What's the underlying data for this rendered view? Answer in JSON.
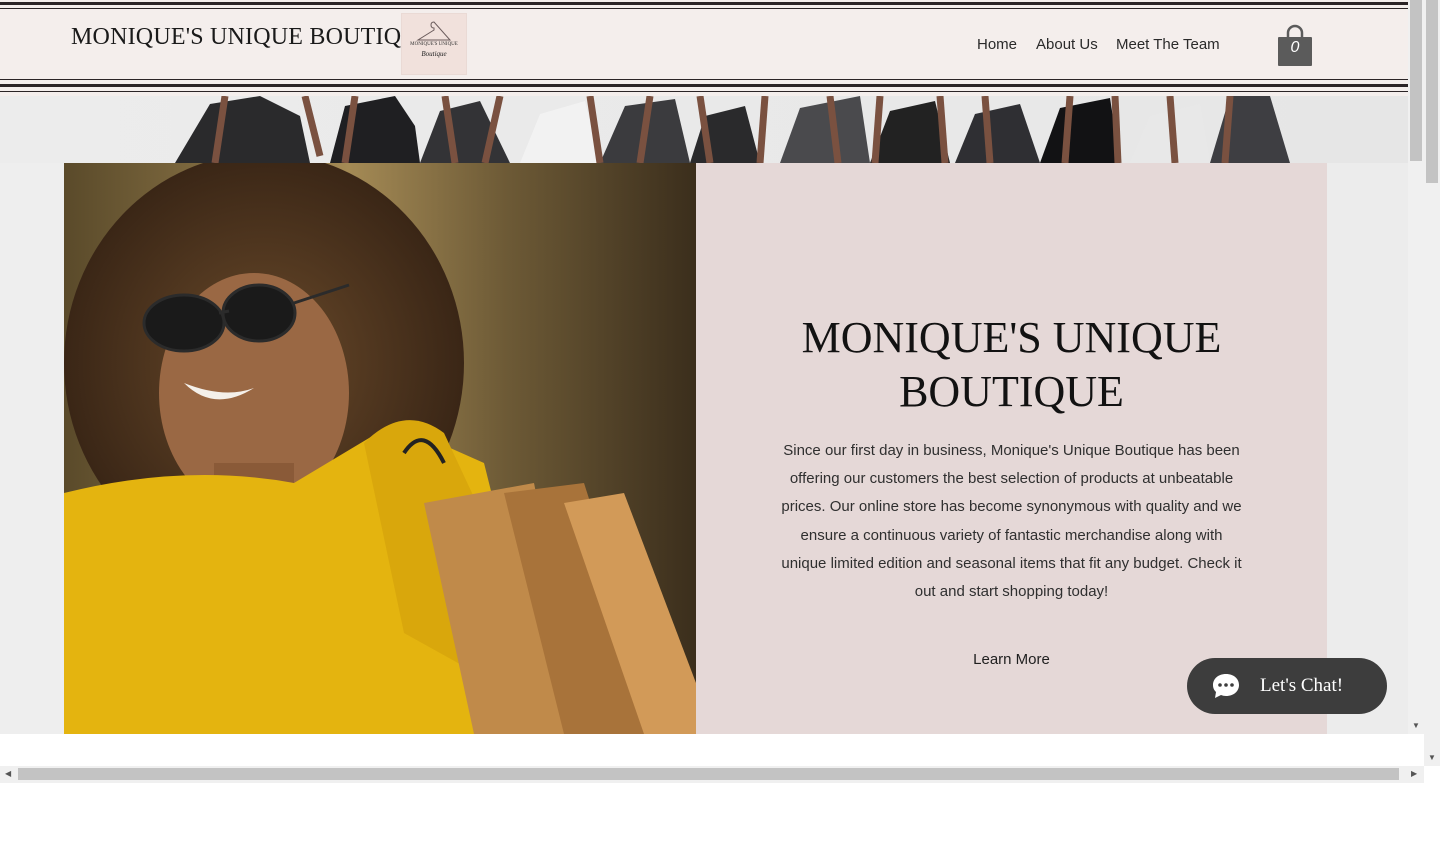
{
  "header": {
    "brand": "MONIQUE'S UNIQUE BOUTIQUE",
    "logo": {
      "line1": "MONIQUE'S UNIQUE",
      "line2": "Boutique"
    },
    "nav": [
      "Home",
      "About Us",
      "Meet The Team"
    ],
    "cart_count": "0"
  },
  "hero": {
    "title_line1": "MONIQUE'S UNIQUE",
    "title_line2": "BOUTIQUE",
    "text": "Since our first day in business, Monique's Unique Boutique has been offering our customers the best selection of products at unbeatable prices. Our online store has become synonymous with quality and we ensure a continuous variety of fantastic merchandise along with unique limited edition and seasonal items that fit any budget. Check it out and start shopping today!",
    "cta": "Learn More",
    "image": "woman-with-shopping-bags"
  },
  "chat": {
    "label": "Let's Chat!",
    "icon": "chat-bubble-icon"
  },
  "colors": {
    "header_bg": "#f4eeec",
    "panel_bg": "#e5d8d7",
    "chat_bg": "#3d3d3d",
    "sweater": "#e4b40f"
  }
}
